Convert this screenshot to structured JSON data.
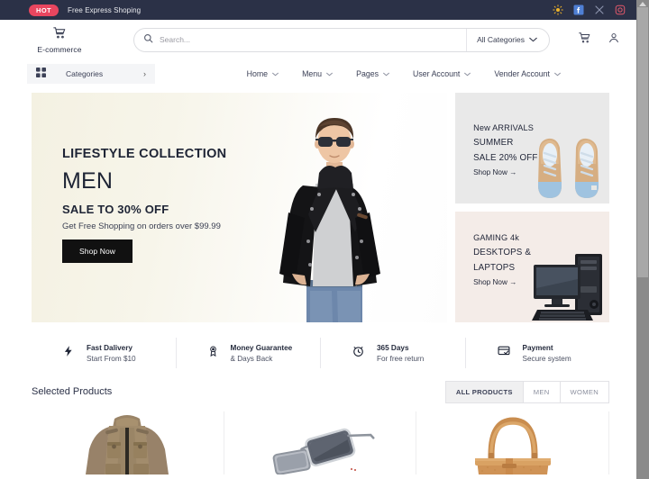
{
  "topbar": {
    "badge": "HOT",
    "promo_text": "Free Express Shoping",
    "icons": [
      "sun-icon",
      "facebook-icon",
      "x-twitter-icon",
      "instagram-icon"
    ],
    "bg_color": "#2b3147",
    "badge_color": "#e8465f"
  },
  "header": {
    "brand": {
      "icon": "shopping-cart-icon",
      "name": "E-commerce"
    },
    "search": {
      "value": "",
      "placeholder": "Search...",
      "icon": "search-icon"
    },
    "category_select": {
      "label": "All Categories",
      "icon": "chevron-down-icon"
    },
    "actions": [
      "cart-icon",
      "user-account-icon"
    ]
  },
  "navbar": {
    "categories_button": {
      "label": "Categories",
      "grid_icon": "grid-icon",
      "chevron": "›"
    },
    "items": [
      {
        "label": "Home",
        "caret": "⌄"
      },
      {
        "label": "Menu",
        "caret": "⌄"
      },
      {
        "label": "Pages",
        "caret": "⌄"
      },
      {
        "label": "User Account",
        "caret": "⌄"
      },
      {
        "label": "Vender Account",
        "caret": "⌄"
      }
    ]
  },
  "hero": {
    "kicker": "LIFESTYLE COLLECTION",
    "title": "MEN",
    "sale": "SALE TO 30% OFF",
    "subtitle": "Get Free Shopping on orders over $99.99",
    "button_label": "Shop Now",
    "image": "man-in-leather-jacket-with-sunglasses",
    "bg_color": "#f4f1e2"
  },
  "promos": [
    {
      "line1": "New ARRIVALS",
      "line2": "SUMMER",
      "line3": "SALE 20% OFF",
      "link": "Shop Now →",
      "image": "tan-sneakers-pair",
      "bg_color": "#e9e9e9"
    },
    {
      "line1": "GAMING 4k",
      "line2": "DESKTOPS &",
      "line3": "LAPTOPS",
      "link": "Shop Now →",
      "image": "desktop-computer-tower-monitor-keyboard",
      "bg_color": "#f4ece8"
    }
  ],
  "features": [
    {
      "icon": "lightning-bolt-icon",
      "title": "Fast Dalivery",
      "subtitle": "Start From $10"
    },
    {
      "icon": "medal-guarantee-icon",
      "title": "Money Guarantee",
      "subtitle": "& Days Back"
    },
    {
      "icon": "alarm-clock-icon",
      "title": "365 Days",
      "subtitle": "For free return"
    },
    {
      "icon": "credit-card-check-icon",
      "title": "Payment",
      "subtitle": "Secure system"
    }
  ],
  "selected_products": {
    "title": "Selected Products",
    "tabs": [
      {
        "label": "ALL PRODUCTS",
        "active": true
      },
      {
        "label": "MEN",
        "active": false
      },
      {
        "label": "WOMEN",
        "active": false
      }
    ],
    "items": [
      {
        "image": "khaki-field-jacket"
      },
      {
        "image": "black-sunglasses-pair"
      },
      {
        "image": "tan-leather-handbag"
      }
    ]
  }
}
